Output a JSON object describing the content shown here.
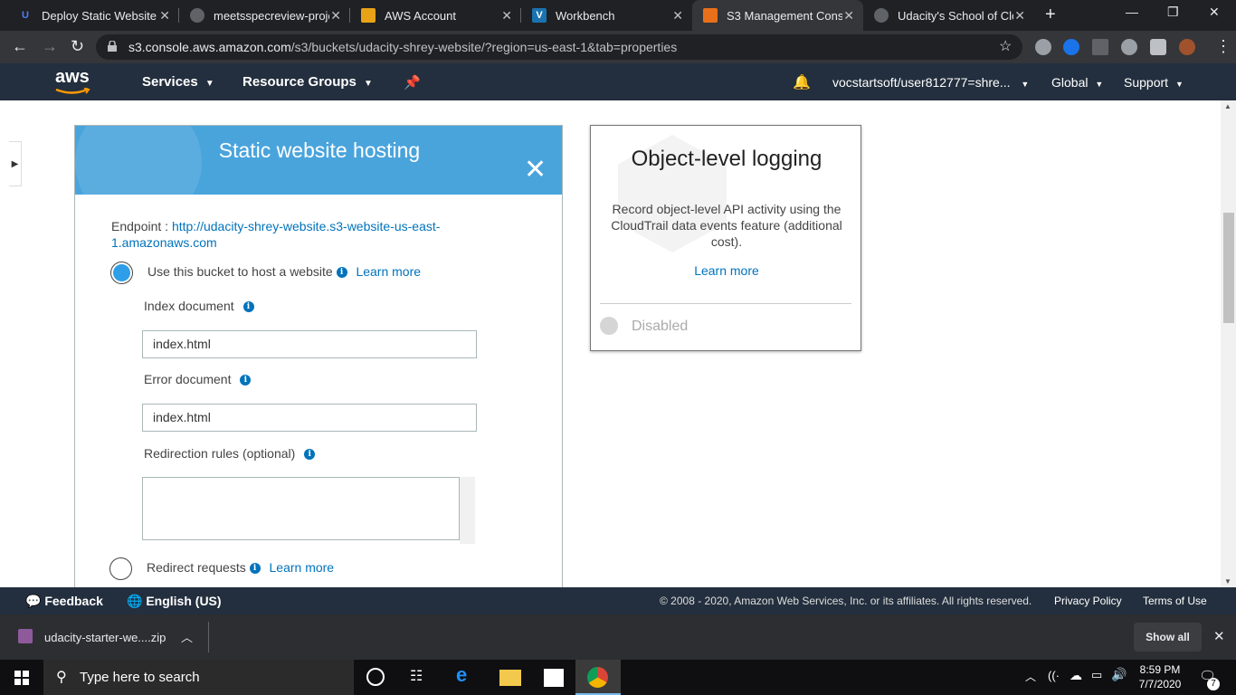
{
  "browser": {
    "tabs": [
      {
        "title": "Deploy Static Website o",
        "favicon_color": "#2015ff",
        "favicon_glyph": "U"
      },
      {
        "title": "meetsspecreview-proje",
        "favicon_color": "#5f6368",
        "favicon_glyph": ""
      },
      {
        "title": "AWS Account",
        "favicon_color": "#e8a317",
        "favicon_glyph": ""
      },
      {
        "title": "Workbench",
        "favicon_color": "#1a73b0",
        "favicon_glyph": "V"
      },
      {
        "title": "S3 Management Conso",
        "favicon_color": "#e8701a",
        "favicon_glyph": ""
      },
      {
        "title": "Udacity's School of Clo",
        "favicon_color": "#5f6368",
        "favicon_glyph": ""
      }
    ],
    "url_host": "s3.console.aws.amazon.com",
    "url_path": "/s3/buckets/udacity-shrey-website/?region=us-east-1&tab=properties"
  },
  "aws_nav": {
    "logo": "aws",
    "services": "Services",
    "resource_groups": "Resource Groups",
    "account": "vocstartsoft/user812777=shre...",
    "region": "Global",
    "support": "Support"
  },
  "hosting": {
    "title": "Static website hosting",
    "endpoint_label": "Endpoint :",
    "endpoint_url_line1": "http://udacity-shrey-website.s3-website-us-east-",
    "endpoint_url_line2": "1.amazonaws.com",
    "use_bucket_label": "Use this bucket to host a website",
    "learn_more": "Learn more",
    "index_label": "Index document",
    "index_value": "index.html",
    "error_label": "Error document",
    "error_value": "index.html",
    "redirection_label": "Redirection rules (optional)",
    "redirect_label": "Redirect requests",
    "redirect_learn_more": "Learn more"
  },
  "logging": {
    "title": "Object-level logging",
    "desc": "Record object-level API activity using the CloudTrail data events feature (additional cost).",
    "learn_more": "Learn more",
    "status": "Disabled"
  },
  "footer": {
    "feedback": "Feedback",
    "language": "English (US)",
    "copyright": "© 2008 - 2020, Amazon Web Services, Inc. or its affiliates. All rights reserved.",
    "privacy": "Privacy Policy",
    "terms": "Terms of Use"
  },
  "download": {
    "filename": "udacity-starter-we....zip",
    "show_all": "Show all"
  },
  "taskbar": {
    "search_placeholder": "Type here to search",
    "time": "8:59 PM",
    "date": "7/7/2020",
    "notifications": "7"
  }
}
